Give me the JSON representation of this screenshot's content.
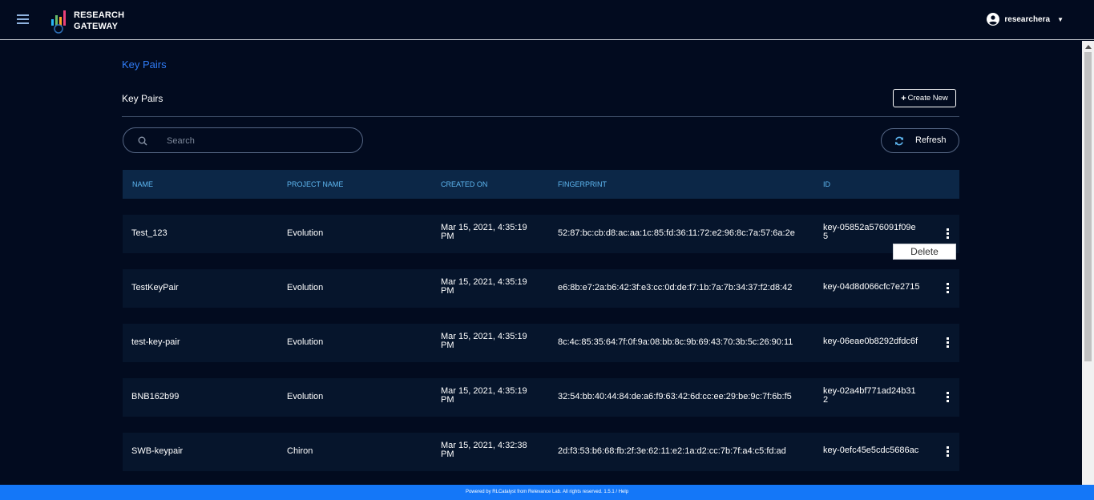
{
  "header": {
    "logo_line1": "RESEARCH",
    "logo_line2": "GATEWAY",
    "username": "researchera",
    "menu_icon": "hamburger-icon",
    "user_icon": "user-circle-icon"
  },
  "breadcrumb": "Key Pairs",
  "section_title": "Key Pairs",
  "create_button": {
    "icon": "+",
    "label": "Create New"
  },
  "search": {
    "placeholder": "Search",
    "value": ""
  },
  "refresh_button": {
    "label": "Refresh"
  },
  "table": {
    "columns": [
      "NAME",
      "PROJECT NAME",
      "CREATED ON",
      "FINGERPRINT",
      "ID"
    ],
    "rows": [
      {
        "name": "Test_123",
        "project": "Evolution",
        "created": "Mar 15, 2021, 4:35:19 PM",
        "fingerprint": "52:87:bc:cb:d8:ac:aa:1c:85:fd:36:11:72:e2:96:8c:7a:57:6a:2e",
        "id": "key-05852a576091f09e5"
      },
      {
        "name": "TestKeyPair",
        "project": "Evolution",
        "created": "Mar 15, 2021, 4:35:19 PM",
        "fingerprint": "e6:8b:e7:2a:b6:42:3f:e3:cc:0d:de:f7:1b:7a:7b:34:37:f2:d8:42",
        "id": "key-04d8d066cfc7e2715"
      },
      {
        "name": "test-key-pair",
        "project": "Evolution",
        "created": "Mar 15, 2021, 4:35:19 PM",
        "fingerprint": "8c:4c:85:35:64:7f:0f:9a:08:bb:8c:9b:69:43:70:3b:5c:26:90:11",
        "id": "key-06eae0b8292dfdc6f"
      },
      {
        "name": "BNB162b99",
        "project": "Evolution",
        "created": "Mar 15, 2021, 4:35:19 PM",
        "fingerprint": "32:54:bb:40:44:84:de:a6:f9:63:42:6d:cc:ee:29:be:9c:7f:6b:f5",
        "id": "key-02a4bf771ad24b312"
      },
      {
        "name": "SWB-keypair",
        "project": "Chiron",
        "created": "Mar 15, 2021, 4:32:38 PM",
        "fingerprint": "2d:f3:53:b6:68:fb:2f:3e:62:11:e2:1a:d2:cc:7b:7f:a4:c5:fd:ad",
        "id": "key-0efc45e5cdc5686ac"
      }
    ]
  },
  "row_menu": {
    "delete_label": "Delete"
  },
  "footer": "Powered by RLCatalyst from Relevance Lab. All rights reserved. 1.5.1 / Help",
  "colors": {
    "background": "#020b1f",
    "header_row": "#0c2747",
    "row": "#06152c",
    "accent_link": "#2f7bf5",
    "column_header_text": "#5eb7f1",
    "footer": "#1477f8"
  }
}
